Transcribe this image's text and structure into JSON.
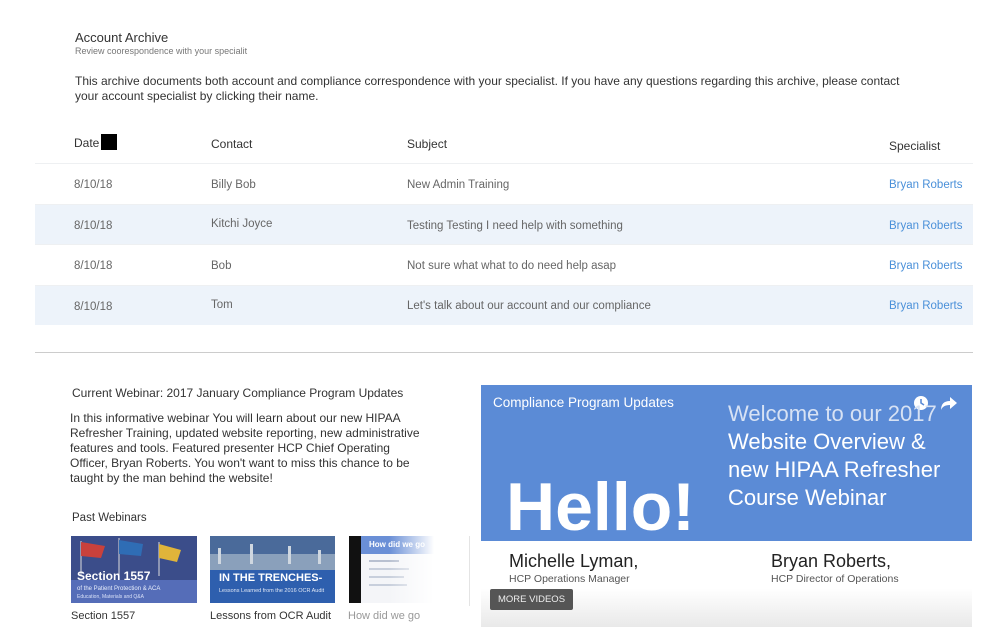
{
  "archive": {
    "title": "Account Archive",
    "subtitle": "Review coorespondence with your specialit",
    "description": "This archive documents both account and compliance correspondence with your specialist.  If you have any questions regarding this archive, please contact your account specialist by clicking their name."
  },
  "table": {
    "headers": {
      "date": "Date",
      "contact": "Contact",
      "subject": "Subject",
      "specialist": "Specialist"
    },
    "rows": [
      {
        "date": "8/10/18",
        "contact": "Billy Bob",
        "subject": "New Admin Training",
        "specialist": "Bryan Roberts"
      },
      {
        "date": "8/10/18",
        "contact": "Kitchi Joyce",
        "subject": "Testing Testing I need help with something",
        "specialist": "Bryan Roberts"
      },
      {
        "date": "8/10/18",
        "contact": "Bob",
        "subject": "Not sure what what  to do need help asap",
        "specialist": "Bryan Roberts"
      },
      {
        "date": "8/10/18",
        "contact": "Tom",
        "subject": "Let's talk about our account and our compliance",
        "specialist": "Bryan Roberts"
      }
    ]
  },
  "webinar": {
    "current_title": "Current Webinar: 2017 January Compliance Program Updates",
    "body": "In this informative webinar You will learn about our new HIPAA Refresher Training, updated website reporting, new administrative features and tools. Featured presenter HCP Chief Operating Officer, Bryan Roberts. You won't want to miss this chance to be taught by the man behind the website!",
    "past_title": "Past Webinars",
    "past": [
      {
        "label": "Section 1557",
        "thumb_title": "Section 1557",
        "thumb_sub": "of the Patient Protection & ACA",
        "thumb_sub2": "Education, Materials and Q&A"
      },
      {
        "label": "Lessons from OCR Audit",
        "thumb_title": "IN THE TRENCHES-",
        "thumb_sub": "Lessons Learned from the 2016 OCR Audit"
      },
      {
        "label": "How did we go",
        "thumb_title": "How did we go"
      }
    ]
  },
  "video": {
    "title": "Compliance Program Updates",
    "welcome_line1": "Welcome to our 2017",
    "welcome_line2": "Website Overview &",
    "welcome_line3": "new HIPAA Refresher",
    "welcome_line4": "Course Webinar",
    "hello": "Hello!",
    "presenter1_name": "Michelle Lyman,",
    "presenter1_role": "HCP Operations Manager",
    "presenter2_name": "Bryan Roberts,",
    "presenter2_role": "HCP Director of Operations",
    "more_videos": "MORE VIDEOS",
    "bg_color": "#5b8bd6"
  },
  "icons": [
    "clock-icon",
    "share-icon"
  ]
}
